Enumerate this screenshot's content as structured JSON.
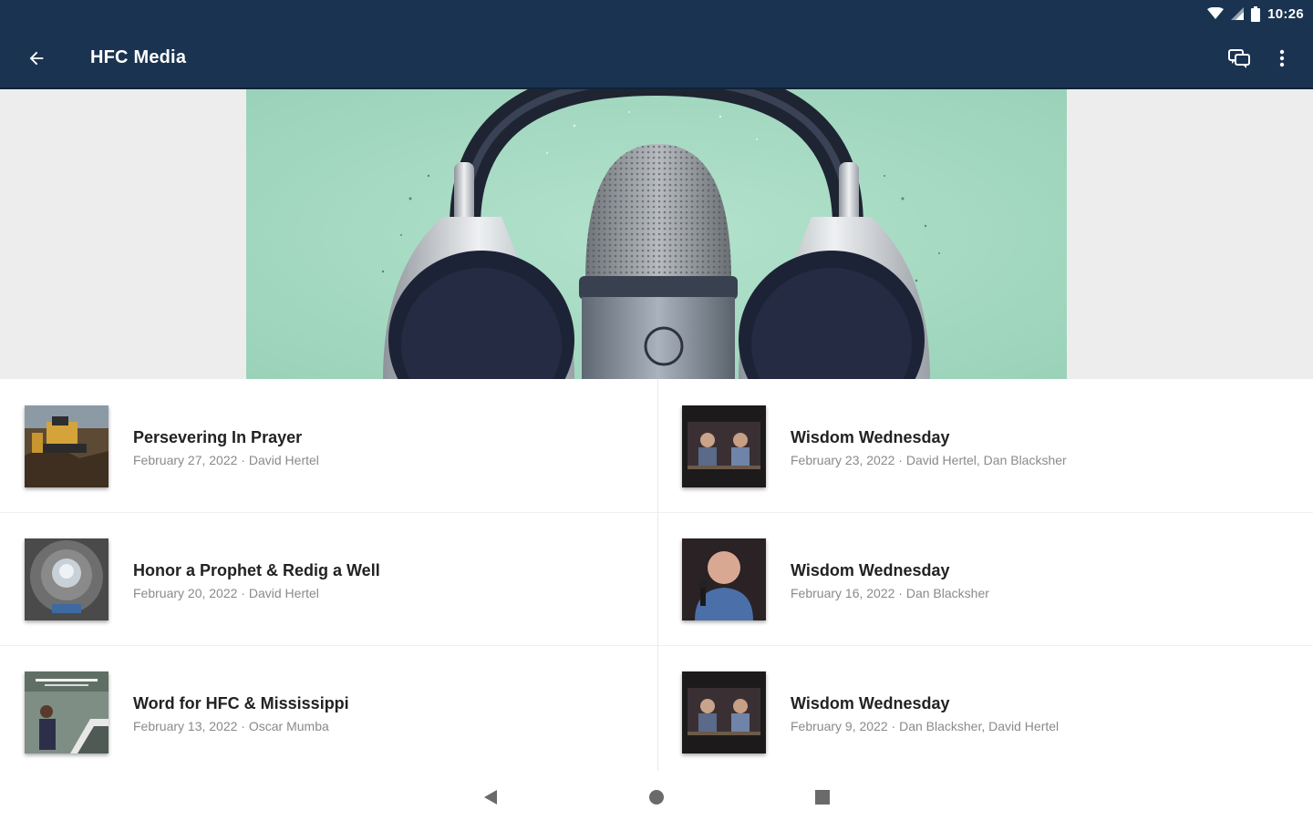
{
  "status_bar": {
    "time": "10:26"
  },
  "app_bar": {
    "title": "HFC Media",
    "back_icon": "arrow-back-icon",
    "chat_icon": "chat-bubbles-icon",
    "more_icon": "more-vert-icon",
    "background": "#1a3350"
  },
  "hero": {
    "image": "headphones-microphone-banner",
    "accent": "#a8dcc5"
  },
  "media_items": [
    {
      "title": "Persevering In Prayer",
      "date": "February 27, 2022",
      "speaker": "David Hertel",
      "thumb": "bulldozer-thumbnail"
    },
    {
      "title": "Wisdom Wednesday",
      "date": "February 23, 2022",
      "speaker": "David Hertel, Dan Blacksher",
      "thumb": "studio-two-hosts-thumbnail"
    },
    {
      "title": "Honor a Prophet & Redig a Well",
      "date": "February 20, 2022",
      "speaker": "David Hertel",
      "thumb": "well-tunnel-thumbnail"
    },
    {
      "title": "Wisdom Wednesday",
      "date": "February 16, 2022",
      "speaker": "Dan Blacksher",
      "thumb": "speaker-with-microphone-thumbnail"
    },
    {
      "title": "Word for HFC & Mississippi",
      "date": "February 13, 2022",
      "speaker": "Oscar Mumba",
      "thumb": "guest-speaker-thumbnail"
    },
    {
      "title": "Wisdom Wednesday",
      "date": "February 9, 2022",
      "speaker": "Dan Blacksher, David Hertel",
      "thumb": "studio-two-hosts-thumbnail"
    }
  ],
  "meta_separator": " · ",
  "nav_bar": {
    "back": "nav-back-icon",
    "home": "nav-home-icon",
    "recents": "nav-recents-icon"
  }
}
